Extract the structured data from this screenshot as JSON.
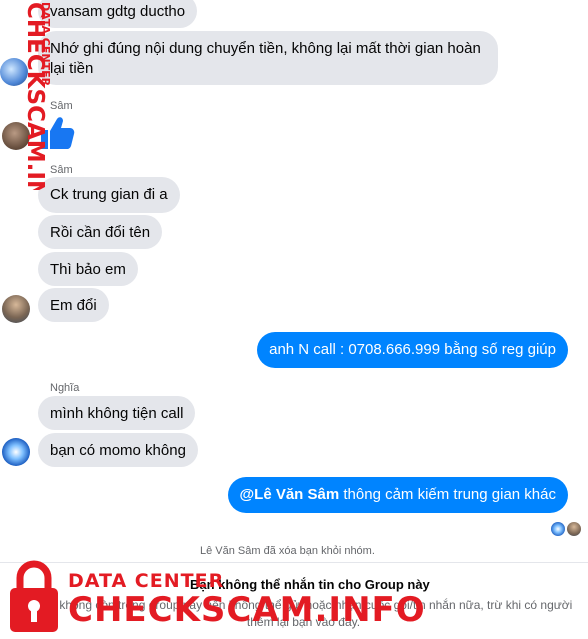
{
  "watermark": {
    "vertical_text": "CHECKSCAM.INFO",
    "vertical_small": "DATA CENTER",
    "logo_top": "DATA CENTER",
    "logo_main": "CHECKSCAM.INFO"
  },
  "messages": [
    {
      "text": "vansam gdtg ductho"
    },
    {
      "text": "Nhớ ghi đúng nội dung chuyển tiền, không lại mất thời gian hoàn lại tiền"
    },
    {
      "sender": "Sâm",
      "type": "like"
    },
    {
      "sender": "Sâm",
      "text": "Ck trung gian đi a"
    },
    {
      "text": "Rồi cần đổi tên"
    },
    {
      "text": "Thì bảo em"
    },
    {
      "text": "Em đổi"
    },
    {
      "outgoing": true,
      "text": "anh N call : 0708.666.999 bằng số reg giúp"
    },
    {
      "sender": "Nghĩa",
      "text": "mình không tiện call"
    },
    {
      "text": "bạn có momo không"
    },
    {
      "outgoing": true,
      "mention": "@Lê Văn Sâm",
      "text": " thông cảm kiếm trung gian khác"
    }
  ],
  "system_notice": "Lê Văn Sâm đã xóa bạn khỏi nhóm.",
  "footer": {
    "title": "Bạn không thể nhắn tin cho Group này",
    "description": "Bạn không còn trong group này nên không thể gửi hoặc nhận cuộc gọi/tin nhắn nữa, trừ khi có người thêm lại bạn vào đây."
  },
  "colors": {
    "outgoing_bubble": "#0084ff",
    "incoming_bubble": "#e4e6eb",
    "like_icon": "#1877f2",
    "watermark_red": "#e31b23"
  }
}
